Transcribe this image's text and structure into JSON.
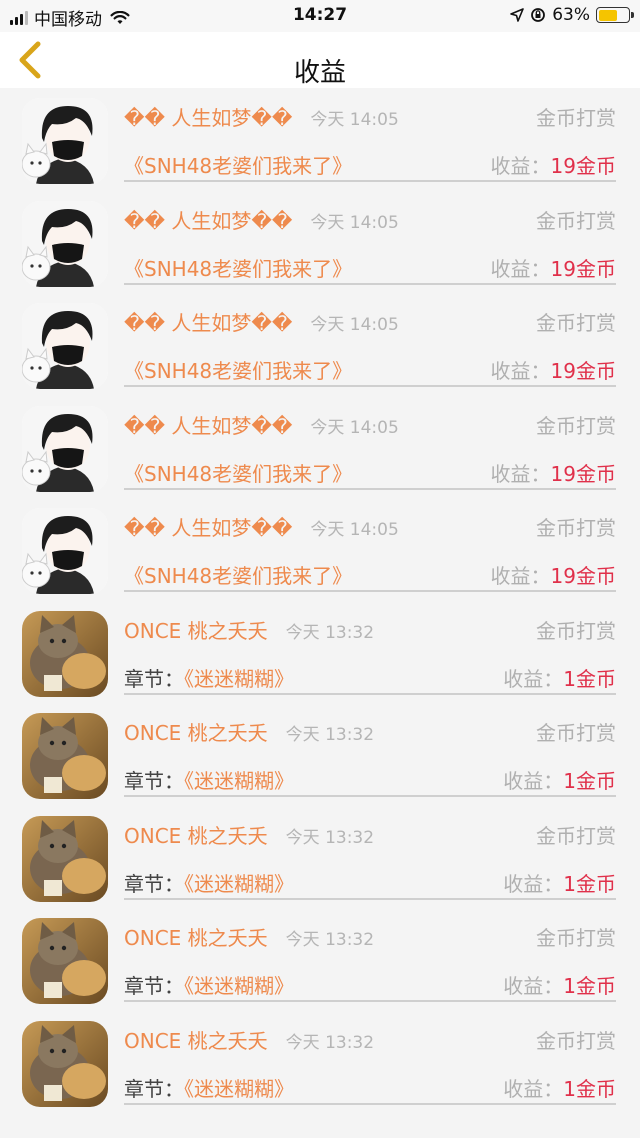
{
  "status": {
    "carrier": "中国移动",
    "time": "14:27",
    "battery": "63%",
    "battery_level": 0.63
  },
  "header": {
    "title": "收益"
  },
  "colors": {
    "accent": "#ee8a4d",
    "amount": "#e0304a",
    "muted": "#b0b0b0"
  },
  "items": [
    {
      "avatar": "boy-cat-avatar",
      "name": "�� 人生如梦��",
      "time": "今天 14:05",
      "type": "金币打赏",
      "chapter_prefix": "",
      "chapter": "《SNH48老婆们我来了》",
      "earn_label": "收益：",
      "amount": "19金币"
    },
    {
      "avatar": "boy-cat-avatar",
      "name": "�� 人生如梦��",
      "time": "今天 14:05",
      "type": "金币打赏",
      "chapter_prefix": "",
      "chapter": "《SNH48老婆们我来了》",
      "earn_label": "收益：",
      "amount": "19金币"
    },
    {
      "avatar": "boy-cat-avatar",
      "name": "�� 人生如梦��",
      "time": "今天 14:05",
      "type": "金币打赏",
      "chapter_prefix": "",
      "chapter": "《SNH48老婆们我来了》",
      "earn_label": "收益：",
      "amount": "19金币"
    },
    {
      "avatar": "boy-cat-avatar",
      "name": "�� 人生如梦��",
      "time": "今天 14:05",
      "type": "金币打赏",
      "chapter_prefix": "",
      "chapter": "《SNH48老婆们我来了》",
      "earn_label": "收益：",
      "amount": "19金币"
    },
    {
      "avatar": "boy-cat-avatar",
      "name": "�� 人生如梦��",
      "time": "今天 14:05",
      "type": "金币打赏",
      "chapter_prefix": "",
      "chapter": "《SNH48老婆们我来了》",
      "earn_label": "收益：",
      "amount": "19金币"
    },
    {
      "avatar": "kitten-avatar",
      "name": "ONCE 桃之夭夭",
      "time": "今天 13:32",
      "type": "金币打赏",
      "chapter_prefix": "章节：",
      "chapter": "《迷迷糊糊》",
      "earn_label": "收益：",
      "amount": "1金币"
    },
    {
      "avatar": "kitten-avatar",
      "name": "ONCE 桃之夭夭",
      "time": "今天 13:32",
      "type": "金币打赏",
      "chapter_prefix": "章节：",
      "chapter": "《迷迷糊糊》",
      "earn_label": "收益：",
      "amount": "1金币"
    },
    {
      "avatar": "kitten-avatar",
      "name": "ONCE 桃之夭夭",
      "time": "今天 13:32",
      "type": "金币打赏",
      "chapter_prefix": "章节：",
      "chapter": "《迷迷糊糊》",
      "earn_label": "收益：",
      "amount": "1金币"
    },
    {
      "avatar": "kitten-avatar",
      "name": "ONCE 桃之夭夭",
      "time": "今天 13:32",
      "type": "金币打赏",
      "chapter_prefix": "章节：",
      "chapter": "《迷迷糊糊》",
      "earn_label": "收益：",
      "amount": "1金币"
    },
    {
      "avatar": "kitten-avatar",
      "name": "ONCE 桃之夭夭",
      "time": "今天 13:32",
      "type": "金币打赏",
      "chapter_prefix": "章节：",
      "chapter": "《迷迷糊糊》",
      "earn_label": "收益：",
      "amount": "1金币"
    }
  ]
}
